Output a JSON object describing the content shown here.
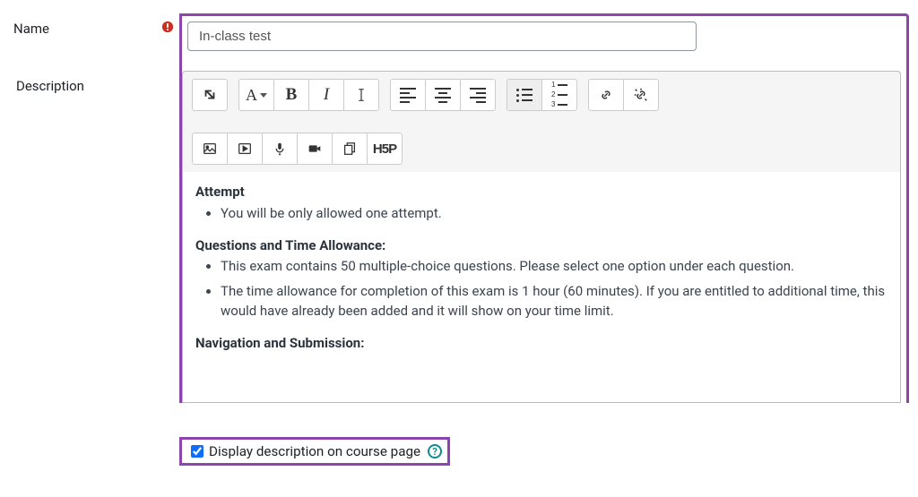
{
  "form": {
    "name_label": "Name",
    "name_value": "In-class test",
    "desc_label": "Description",
    "display_label": "Display description on course page",
    "display_checked": true
  },
  "toolbar": {
    "expand": "↴",
    "font": "A",
    "bold": "B",
    "italic": "I",
    "h5p": "H5P"
  },
  "description_content": {
    "sections": [
      {
        "heading": "Attempt",
        "items": [
          "You will be only allowed one attempt."
        ]
      },
      {
        "heading": "Questions and Time Allowance:",
        "items": [
          "This exam contains 50 multiple-choice questions.  Please select one option under each question.",
          "The time allowance for completion of this exam is 1 hour (60 minutes). If you are entitled to additional time, this would have already been added and it will show on your time limit."
        ]
      },
      {
        "heading": "Navigation and Submission:",
        "items": []
      }
    ]
  }
}
